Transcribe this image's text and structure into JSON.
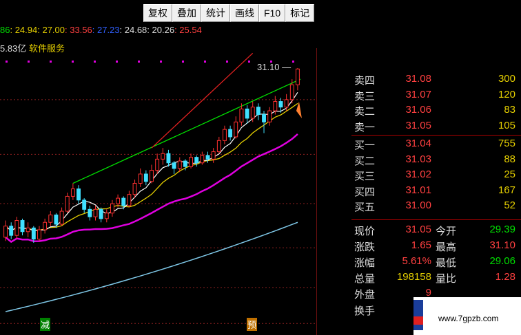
{
  "toolbar": {
    "buttons": [
      "复权",
      "叠加",
      "统计",
      "画线",
      "F10",
      "标记"
    ]
  },
  "ma_values": [
    {
      "text": "86",
      "color": "#00e000"
    },
    {
      "text": ": 24.94",
      "color": "#e6d000"
    },
    {
      "text": ": 27.00",
      "color": "#e6d000"
    },
    {
      "text": ": 33.56",
      "color": "#ff4040"
    },
    {
      "text": ": 27.23",
      "color": "#3060ff"
    },
    {
      "text": ": 24.68",
      "color": "#dddddd"
    },
    {
      "text": ": 20.26",
      "color": "#dddddd"
    },
    {
      "text": ": 25.54",
      "color": "#ff4040"
    }
  ],
  "info": {
    "cap": "5.83亿",
    "sector": "软件服务"
  },
  "price_tag": "31.10",
  "markers": {
    "reduce": "减",
    "pre": "预"
  },
  "axis": {
    "ticks": [
      "29.40",
      "26.46",
      "23.81",
      "21.43",
      "19.29",
      "17.36"
    ],
    "color": "#ff3030"
  },
  "order_book": [
    {
      "label": "卖四",
      "price": "31.08",
      "vol": "300"
    },
    {
      "label": "卖三",
      "price": "31.07",
      "vol": "120"
    },
    {
      "label": "卖二",
      "price": "31.06",
      "vol": "83"
    },
    {
      "label": "卖一",
      "price": "31.05",
      "vol": "105"
    },
    {
      "label": "买一",
      "price": "31.04",
      "vol": "755"
    },
    {
      "label": "买二",
      "price": "31.03",
      "vol": "88"
    },
    {
      "label": "买三",
      "price": "31.02",
      "vol": "25"
    },
    {
      "label": "买四",
      "price": "31.01",
      "vol": "167"
    },
    {
      "label": "买五",
      "price": "31.00",
      "vol": "52"
    }
  ],
  "summary": [
    {
      "l1": "现价",
      "v1": "31.05",
      "c1": "red",
      "l2": "今开",
      "v2": "29.39",
      "c2": "green"
    },
    {
      "l1": "涨跌",
      "v1": "1.65",
      "c1": "red",
      "l2": "最高",
      "v2": "31.10",
      "c2": "red"
    },
    {
      "l1": "涨幅",
      "v1": "5.61%",
      "c1": "red",
      "l2": "最低",
      "v2": "29.06",
      "c2": "green"
    },
    {
      "l1": "总量",
      "v1": "198158",
      "c1": "yellow",
      "l2": "量比",
      "v2": "1.28",
      "c2": "red"
    },
    {
      "l1": "外盘",
      "v1": "9",
      "c1": "red",
      "l2": "",
      "v2": "",
      "c2": "red"
    },
    {
      "l1": "换手",
      "v1": "",
      "c1": "red",
      "l2": "",
      "v2": "",
      "c2": "red"
    }
  ],
  "watermark": {
    "site": "www.7gpzb.com"
  },
  "colors": {
    "up": "#ff3030",
    "down": "#40e0ff",
    "ma_short": "#ffffff",
    "ma_mid": "#e6d000",
    "ma_long": "#e000e0",
    "ma_xlong": "#7fc8e8",
    "channel_upper": "#00e000",
    "channel_red": "#e02020"
  },
  "chart_data": {
    "type": "candlestick",
    "y_axis_ticks": [
      29.4,
      26.46,
      23.81,
      21.43,
      19.29,
      17.36
    ],
    "ylim": [
      17.0,
      31.8
    ],
    "trend": "rising",
    "candles": [
      {
        "o": 22.0,
        "c": 22.6,
        "h": 22.9,
        "l": 21.8
      },
      {
        "o": 22.6,
        "c": 22.1,
        "h": 22.8,
        "l": 21.9
      },
      {
        "o": 22.1,
        "c": 22.9,
        "h": 23.1,
        "l": 21.9
      },
      {
        "o": 22.9,
        "c": 22.3,
        "h": 23.0,
        "l": 22.1
      },
      {
        "o": 22.3,
        "c": 22.5,
        "h": 22.8,
        "l": 22.0
      },
      {
        "o": 22.5,
        "c": 21.9,
        "h": 22.6,
        "l": 21.7
      },
      {
        "o": 21.9,
        "c": 22.4,
        "h": 22.6,
        "l": 21.8
      },
      {
        "o": 22.4,
        "c": 22.8,
        "h": 23.0,
        "l": 22.2
      },
      {
        "o": 22.8,
        "c": 23.2,
        "h": 23.4,
        "l": 22.6
      },
      {
        "o": 23.2,
        "c": 22.7,
        "h": 23.3,
        "l": 22.5
      },
      {
        "o": 22.7,
        "c": 23.4,
        "h": 23.6,
        "l": 22.6
      },
      {
        "o": 23.4,
        "c": 24.2,
        "h": 24.4,
        "l": 23.3
      },
      {
        "o": 24.2,
        "c": 24.6,
        "h": 24.9,
        "l": 24.0
      },
      {
        "o": 24.6,
        "c": 24.0,
        "h": 24.8,
        "l": 23.8
      },
      {
        "o": 24.0,
        "c": 23.5,
        "h": 24.1,
        "l": 23.3
      },
      {
        "o": 23.5,
        "c": 23.1,
        "h": 23.7,
        "l": 22.9
      },
      {
        "o": 23.1,
        "c": 23.5,
        "h": 23.7,
        "l": 22.9
      },
      {
        "o": 23.5,
        "c": 23.0,
        "h": 23.6,
        "l": 22.8
      },
      {
        "o": 23.0,
        "c": 23.3,
        "h": 23.5,
        "l": 22.8
      },
      {
        "o": 23.3,
        "c": 23.8,
        "h": 24.0,
        "l": 23.1
      },
      {
        "o": 23.8,
        "c": 24.1,
        "h": 24.3,
        "l": 23.6
      },
      {
        "o": 24.1,
        "c": 23.7,
        "h": 24.2,
        "l": 23.5
      },
      {
        "o": 23.7,
        "c": 24.3,
        "h": 24.5,
        "l": 23.6
      },
      {
        "o": 24.3,
        "c": 24.9,
        "h": 25.1,
        "l": 24.1
      },
      {
        "o": 24.9,
        "c": 25.4,
        "h": 25.7,
        "l": 24.7
      },
      {
        "o": 25.4,
        "c": 25.0,
        "h": 25.6,
        "l": 24.8
      },
      {
        "o": 25.0,
        "c": 25.6,
        "h": 25.9,
        "l": 24.9
      },
      {
        "o": 25.6,
        "c": 26.2,
        "h": 26.5,
        "l": 25.4
      },
      {
        "o": 26.2,
        "c": 26.5,
        "h": 26.8,
        "l": 25.9
      },
      {
        "o": 26.5,
        "c": 26.0,
        "h": 26.7,
        "l": 25.8
      },
      {
        "o": 26.0,
        "c": 25.7,
        "h": 26.1,
        "l": 25.4
      },
      {
        "o": 25.7,
        "c": 26.1,
        "h": 26.3,
        "l": 25.5
      },
      {
        "o": 26.1,
        "c": 25.8,
        "h": 26.2,
        "l": 25.6
      },
      {
        "o": 25.8,
        "c": 26.3,
        "h": 26.5,
        "l": 25.7
      },
      {
        "o": 26.3,
        "c": 26.0,
        "h": 26.4,
        "l": 25.8
      },
      {
        "o": 26.0,
        "c": 26.4,
        "h": 26.6,
        "l": 25.9
      },
      {
        "o": 26.4,
        "c": 26.2,
        "h": 26.6,
        "l": 26.0
      },
      {
        "o": 26.2,
        "c": 26.6,
        "h": 26.8,
        "l": 26.0
      },
      {
        "o": 26.6,
        "c": 27.2,
        "h": 27.4,
        "l": 26.5
      },
      {
        "o": 27.2,
        "c": 27.8,
        "h": 28.0,
        "l": 27.0
      },
      {
        "o": 27.8,
        "c": 27.4,
        "h": 28.0,
        "l": 27.2
      },
      {
        "o": 27.4,
        "c": 28.2,
        "h": 28.5,
        "l": 27.3
      },
      {
        "o": 28.2,
        "c": 28.9,
        "h": 29.2,
        "l": 28.0
      },
      {
        "o": 28.9,
        "c": 28.4,
        "h": 29.1,
        "l": 28.1
      },
      {
        "o": 28.4,
        "c": 29.0,
        "h": 29.3,
        "l": 28.2
      },
      {
        "o": 29.0,
        "c": 28.6,
        "h": 29.2,
        "l": 28.3
      },
      {
        "o": 28.6,
        "c": 28.2,
        "h": 28.8,
        "l": 27.6
      },
      {
        "o": 28.2,
        "c": 28.8,
        "h": 29.0,
        "l": 28.0
      },
      {
        "o": 28.8,
        "c": 29.3,
        "h": 29.6,
        "l": 28.6
      },
      {
        "o": 29.3,
        "c": 29.0,
        "h": 29.5,
        "l": 28.7
      },
      {
        "o": 29.0,
        "c": 29.4,
        "h": 29.7,
        "l": 28.8
      },
      {
        "o": 29.4,
        "c": 30.2,
        "h": 30.5,
        "l": 29.2
      },
      {
        "o": 30.2,
        "c": 31.05,
        "h": 31.1,
        "l": 29.9
      }
    ]
  }
}
